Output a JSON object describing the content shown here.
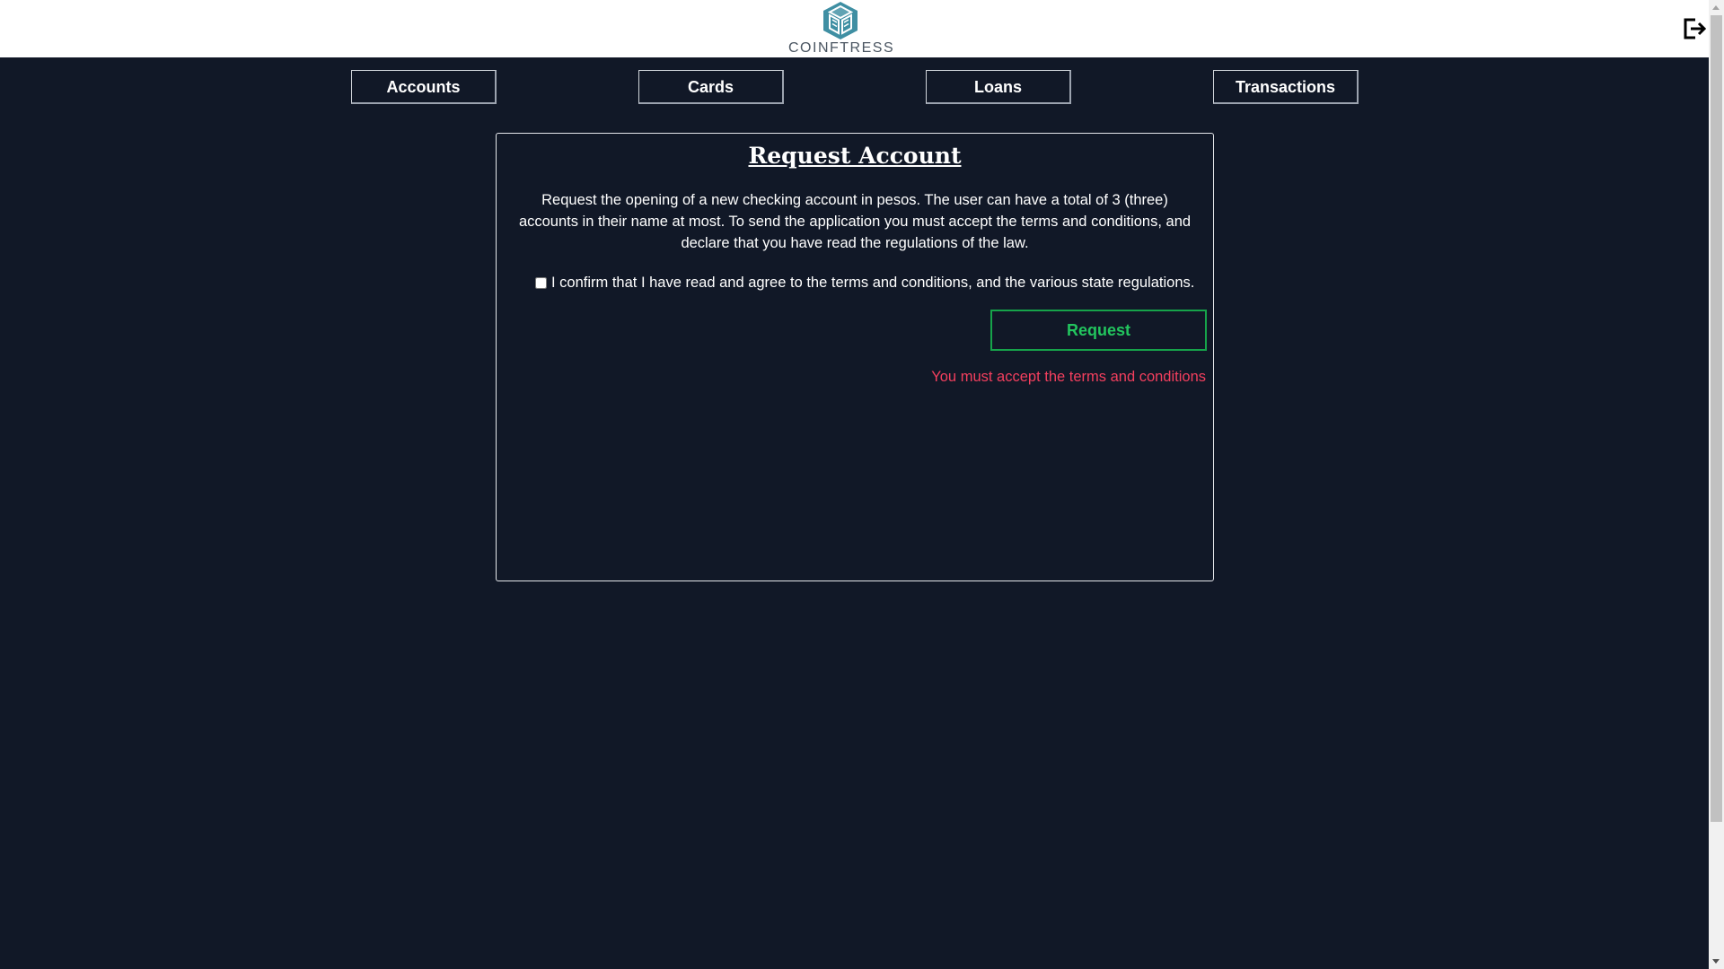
{
  "header": {
    "logo_text": "COINFTRESS",
    "logout_icon": "logout-icon"
  },
  "nav": {
    "items": [
      {
        "label": "Accounts"
      },
      {
        "label": "Cards"
      },
      {
        "label": "Loans"
      },
      {
        "label": "Transactions"
      }
    ]
  },
  "request_account": {
    "title": "Request Account",
    "description": "Request the opening of a new checking account in pesos. The user can have a total of 3 (three) accounts in their name at most. To send the application you must accept the terms and conditions, and declare that you have read the regulations of the law.",
    "confirm_label": "I confirm that I have read and agree to the terms and conditions, and the various state regulations.",
    "confirm_checked": false,
    "request_button": "Request",
    "error_message": "You must accept the terms and conditions"
  },
  "colors": {
    "background": "#111827",
    "accent_green": "#22c55e",
    "error_red": "#f43f5e",
    "logo_teal": "#3f8fa3"
  }
}
